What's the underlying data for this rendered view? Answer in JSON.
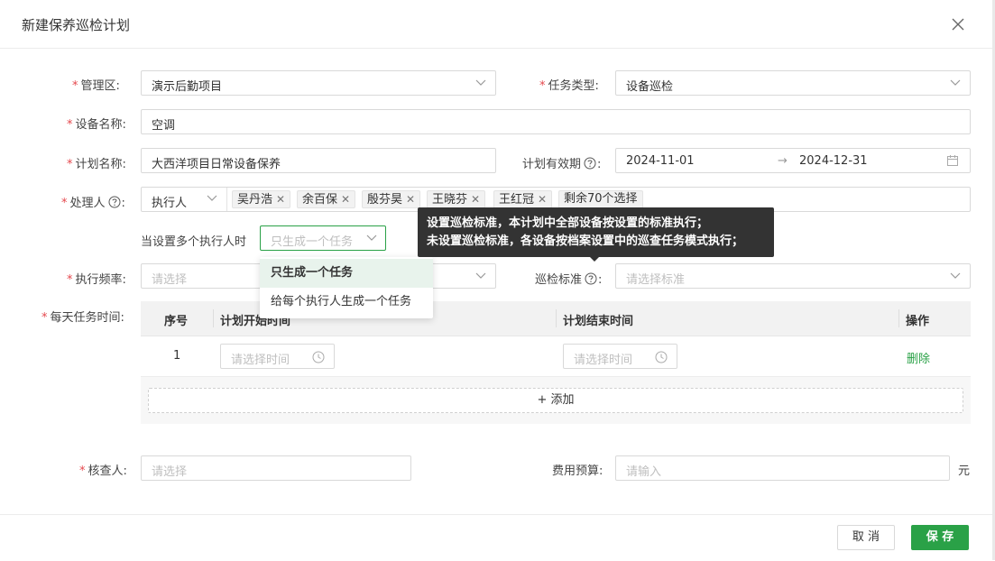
{
  "dialog": {
    "title": "新建保养巡检计划"
  },
  "form": {
    "management_area": {
      "label": "管理区:",
      "value": "演示后勤项目"
    },
    "task_type": {
      "label": "任务类型:",
      "value": "设备巡检"
    },
    "device_name": {
      "label": "设备名称:",
      "value": "空调"
    },
    "plan_name": {
      "label": "计划名称:",
      "value": "大西洋项目日常设备保养"
    },
    "validity": {
      "label": "计划有效期",
      "start": "2024-11-01",
      "arrow": "→",
      "end": "2024-12-31"
    },
    "handler": {
      "label": "处理人",
      "role": "执行人",
      "tags": [
        "吴丹浩",
        "余百保",
        "殷芬昊",
        "王晓芬",
        "王红冠"
      ],
      "more": "剩余70个选择"
    },
    "multi_executor": {
      "label": "当设置多个执行人时",
      "placeholder": "只生成一个任务"
    },
    "frequency": {
      "label": "执行频率:",
      "placeholder": "请选择"
    },
    "standard": {
      "label": "巡检标准",
      "placeholder": "请选择标准"
    },
    "daily_time": {
      "label": "每天任务时间:"
    },
    "reviewer": {
      "label": "核查人:",
      "placeholder": "请选择"
    },
    "budget": {
      "label": "费用预算:",
      "placeholder": "请输入",
      "unit": "元"
    }
  },
  "dropdown": {
    "options": [
      "只生成一个任务",
      "给每个执行人生成一个任务"
    ]
  },
  "tooltip": {
    "line1": "设置巡检标准，本计划中全部设备按设置的标准执行；",
    "line2": "未设置巡检标准，各设备按档案设置中的巡查任务模式执行；"
  },
  "table": {
    "headers": {
      "index": "序号",
      "start": "计划开始时间",
      "end": "计划结束时间",
      "action": "操作"
    },
    "rows": [
      {
        "index": "1",
        "start_placeholder": "请选择时间",
        "end_placeholder": "请选择时间",
        "action": "删除"
      }
    ],
    "add_label": "+ 添加"
  },
  "footer": {
    "cancel": "取 消",
    "save": "保 存"
  },
  "colors": {
    "primary": "#2aa147",
    "required": "#e5484d",
    "tooltip_bg": "#333333"
  }
}
